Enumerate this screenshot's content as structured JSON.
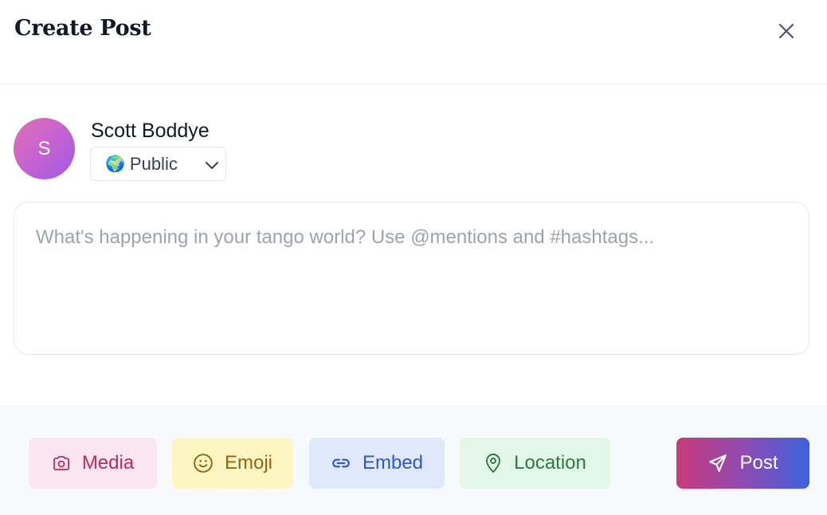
{
  "header": {
    "title": "Create Post",
    "close_icon": "close-icon"
  },
  "author": {
    "avatar_initial": "S",
    "name": "Scott Boddye",
    "visibility": {
      "emoji": "🌍",
      "label": "Public",
      "icon": "chevron-down-icon"
    }
  },
  "composer": {
    "placeholder": "What's happening in your tango world? Use @mentions and #hashtags..."
  },
  "actions": {
    "media": {
      "label": "Media",
      "icon": "camera-icon",
      "color": "#b82b64",
      "bg": "#fbe5ee"
    },
    "emoji": {
      "label": "Emoji",
      "icon": "smile-icon",
      "color": "#99620c",
      "bg": "#fdf6c3"
    },
    "embed": {
      "label": "Embed",
      "icon": "link-icon",
      "color": "#2f57c9",
      "bg": "#dfe9fb"
    },
    "location": {
      "label": "Location",
      "icon": "map-pin-icon",
      "color": "#2d7a40",
      "bg": "#e2f7e7"
    },
    "post": {
      "label": "Post",
      "icon": "send-icon",
      "gradient": [
        "#c93a78",
        "#3d62dd"
      ]
    }
  }
}
